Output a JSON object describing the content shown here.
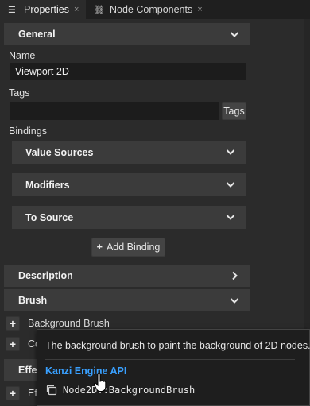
{
  "tabs": [
    {
      "label": "Properties",
      "icon": "list-icon",
      "close": "×"
    },
    {
      "label": "Node Components",
      "icon": "nodes-icon",
      "close": "×"
    }
  ],
  "general": {
    "header": "General",
    "name_label": "Name",
    "name_value": "Viewport 2D",
    "tags_label": "Tags",
    "tags_value": "",
    "tags_button": "Tags",
    "bindings_label": "Bindings",
    "value_sources": "Value Sources",
    "modifiers": "Modifiers",
    "to_source": "To Source",
    "add_binding": "Add Binding"
  },
  "description": {
    "header": "Description"
  },
  "brush": {
    "header": "Brush",
    "background_brush": "Background Brush",
    "second_row_partial": "Co"
  },
  "effects": {
    "header_partial": "Effe",
    "row_partial": "Ef"
  },
  "tooltip": {
    "text": "The background brush to paint the background of 2D nodes.",
    "link": "Kanzi Engine API",
    "code": "Node2D::BackgroundBrush"
  },
  "colors": {
    "panel": "#2b2b2b",
    "header": "#3b3b3b",
    "link": "#39a0ff"
  }
}
